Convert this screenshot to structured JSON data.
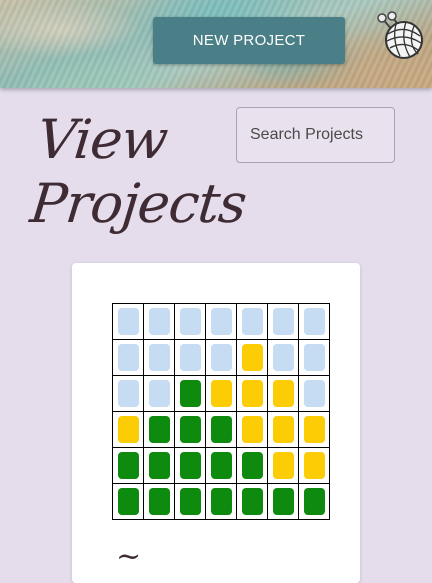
{
  "header": {
    "new_project_label": "NEW PROJECT",
    "logo_icon": "yarn-ball-needles-icon"
  },
  "page": {
    "title": "View Projects"
  },
  "search": {
    "placeholder": "Search Projects",
    "value": ""
  },
  "colors": {
    "B": "#c5dcf3",
    "Y": "#fccc05",
    "G": "#0e8a0e",
    "background": "#e5ddeb",
    "button": "#4b7f87",
    "title": "#3e2b33"
  },
  "project_card": {
    "title_peek": "~",
    "grid": [
      [
        "B",
        "B",
        "B",
        "B",
        "B",
        "B",
        "B"
      ],
      [
        "B",
        "B",
        "B",
        "B",
        "Y",
        "B",
        "B"
      ],
      [
        "B",
        "B",
        "G",
        "Y",
        "Y",
        "Y",
        "B"
      ],
      [
        "Y",
        "G",
        "G",
        "G",
        "Y",
        "Y",
        "Y"
      ],
      [
        "G",
        "G",
        "G",
        "G",
        "G",
        "Y",
        "Y"
      ],
      [
        "G",
        "G",
        "G",
        "G",
        "G",
        "G",
        "G"
      ]
    ]
  }
}
